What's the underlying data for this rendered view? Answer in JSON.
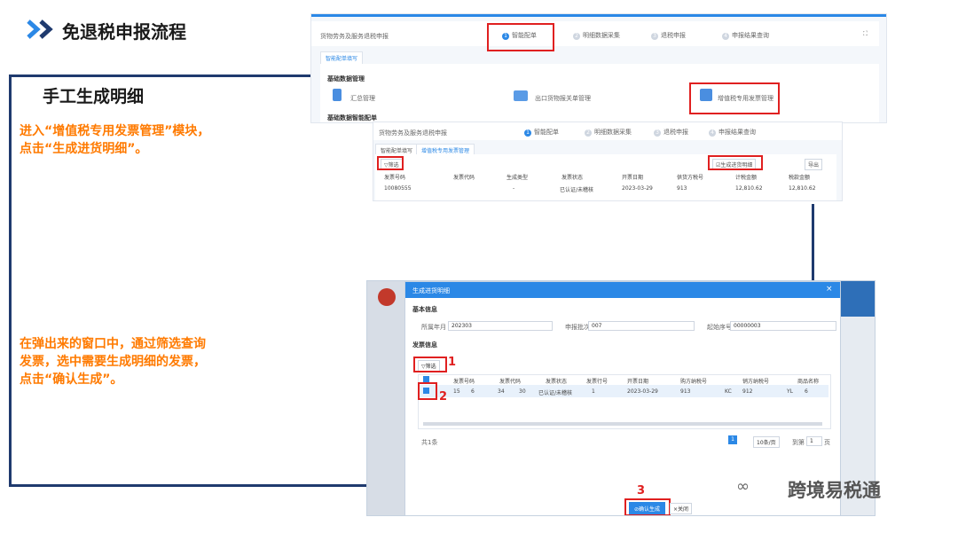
{
  "slide": {
    "title": "免退税申报流程",
    "subtitle": "手工生成明细",
    "instruction1_line1": "进入“增值税专用发票管理”模块，",
    "instruction1_line2": "点击“生成进货明细”。",
    "instruction2_line1": "在弹出来的窗口中，通过筛选查询",
    "instruction2_line2": "发票，选中需要生成明细的发票，",
    "instruction2_line3": "点击“确认生成”。",
    "watermark": "跨境易税通"
  },
  "shot1": {
    "breadcrumb": "货物劳务及服务退税申报",
    "steps": [
      {
        "num": "1",
        "label": "智能配单"
      },
      {
        "num": "2",
        "label": "明细数据采集"
      },
      {
        "num": "3",
        "label": "退税申报"
      },
      {
        "num": "4",
        "label": "申报结果查询"
      }
    ],
    "tab": "智能配单填写",
    "section1": "基础数据管理",
    "section2": "基础数据智能配单",
    "modules": [
      {
        "label": "汇总管理"
      },
      {
        "label": "出口货物报关单管理"
      },
      {
        "label": "增值税专用发票管理"
      }
    ]
  },
  "shot2": {
    "breadcrumb": "货物劳务及服务退税申报",
    "steps": [
      {
        "num": "1",
        "label": "智能配单"
      },
      {
        "num": "2",
        "label": "明细数据采集"
      },
      {
        "num": "3",
        "label": "退税申报"
      },
      {
        "num": "4",
        "label": "申报结果查询"
      }
    ],
    "tabs": [
      "智能配单填写",
      "增值税专用发票管理"
    ],
    "filter_label": "筛选",
    "generate_label": "生成进货明细",
    "export_label": "导出",
    "columns": [
      "发票号码",
      "发票代码",
      "生成类型",
      "发票状态",
      "开票日期",
      "供货方税号",
      "计税金额",
      "税款金额"
    ],
    "row": [
      "10080555",
      "",
      "-",
      "已认证/未稽核",
      "2023-03-29",
      "913",
      "12,810.62",
      "12,810.62"
    ]
  },
  "modal": {
    "title": "生成进货明细",
    "basic_section": "基本信息",
    "fields": [
      {
        "label": "所属年月",
        "value": "202303"
      },
      {
        "label": "申报批次",
        "value": "007"
      },
      {
        "label": "起始序号",
        "value": "00000003"
      }
    ],
    "invoice_section": "发票信息",
    "filter_label": "筛选",
    "columns": [
      "发票号码",
      "发票代码",
      "发票状态",
      "发票行号",
      "开票日期",
      "购方纳税号",
      "销方纳税号",
      "商品名称"
    ],
    "row": [
      "15",
      "6",
      "34",
      "30",
      "已认证/未稽核",
      "1",
      "2023-03-29",
      "913",
      "KC",
      "912",
      "YL",
      "6"
    ],
    "footer_count": "共1条",
    "page_size": "10条/页",
    "goto_label": "到第",
    "goto_value": "1",
    "page_unit": "页",
    "current_page": "1",
    "confirm_label": "确认生成",
    "close_label": "关闭"
  },
  "annotations": {
    "n1": "1",
    "n2": "2",
    "n3": "3"
  },
  "colors": {
    "accent": "#2b88e6",
    "highlight": "#e02020",
    "instruction": "#ff7a00",
    "frame": "#1f3a6e"
  }
}
